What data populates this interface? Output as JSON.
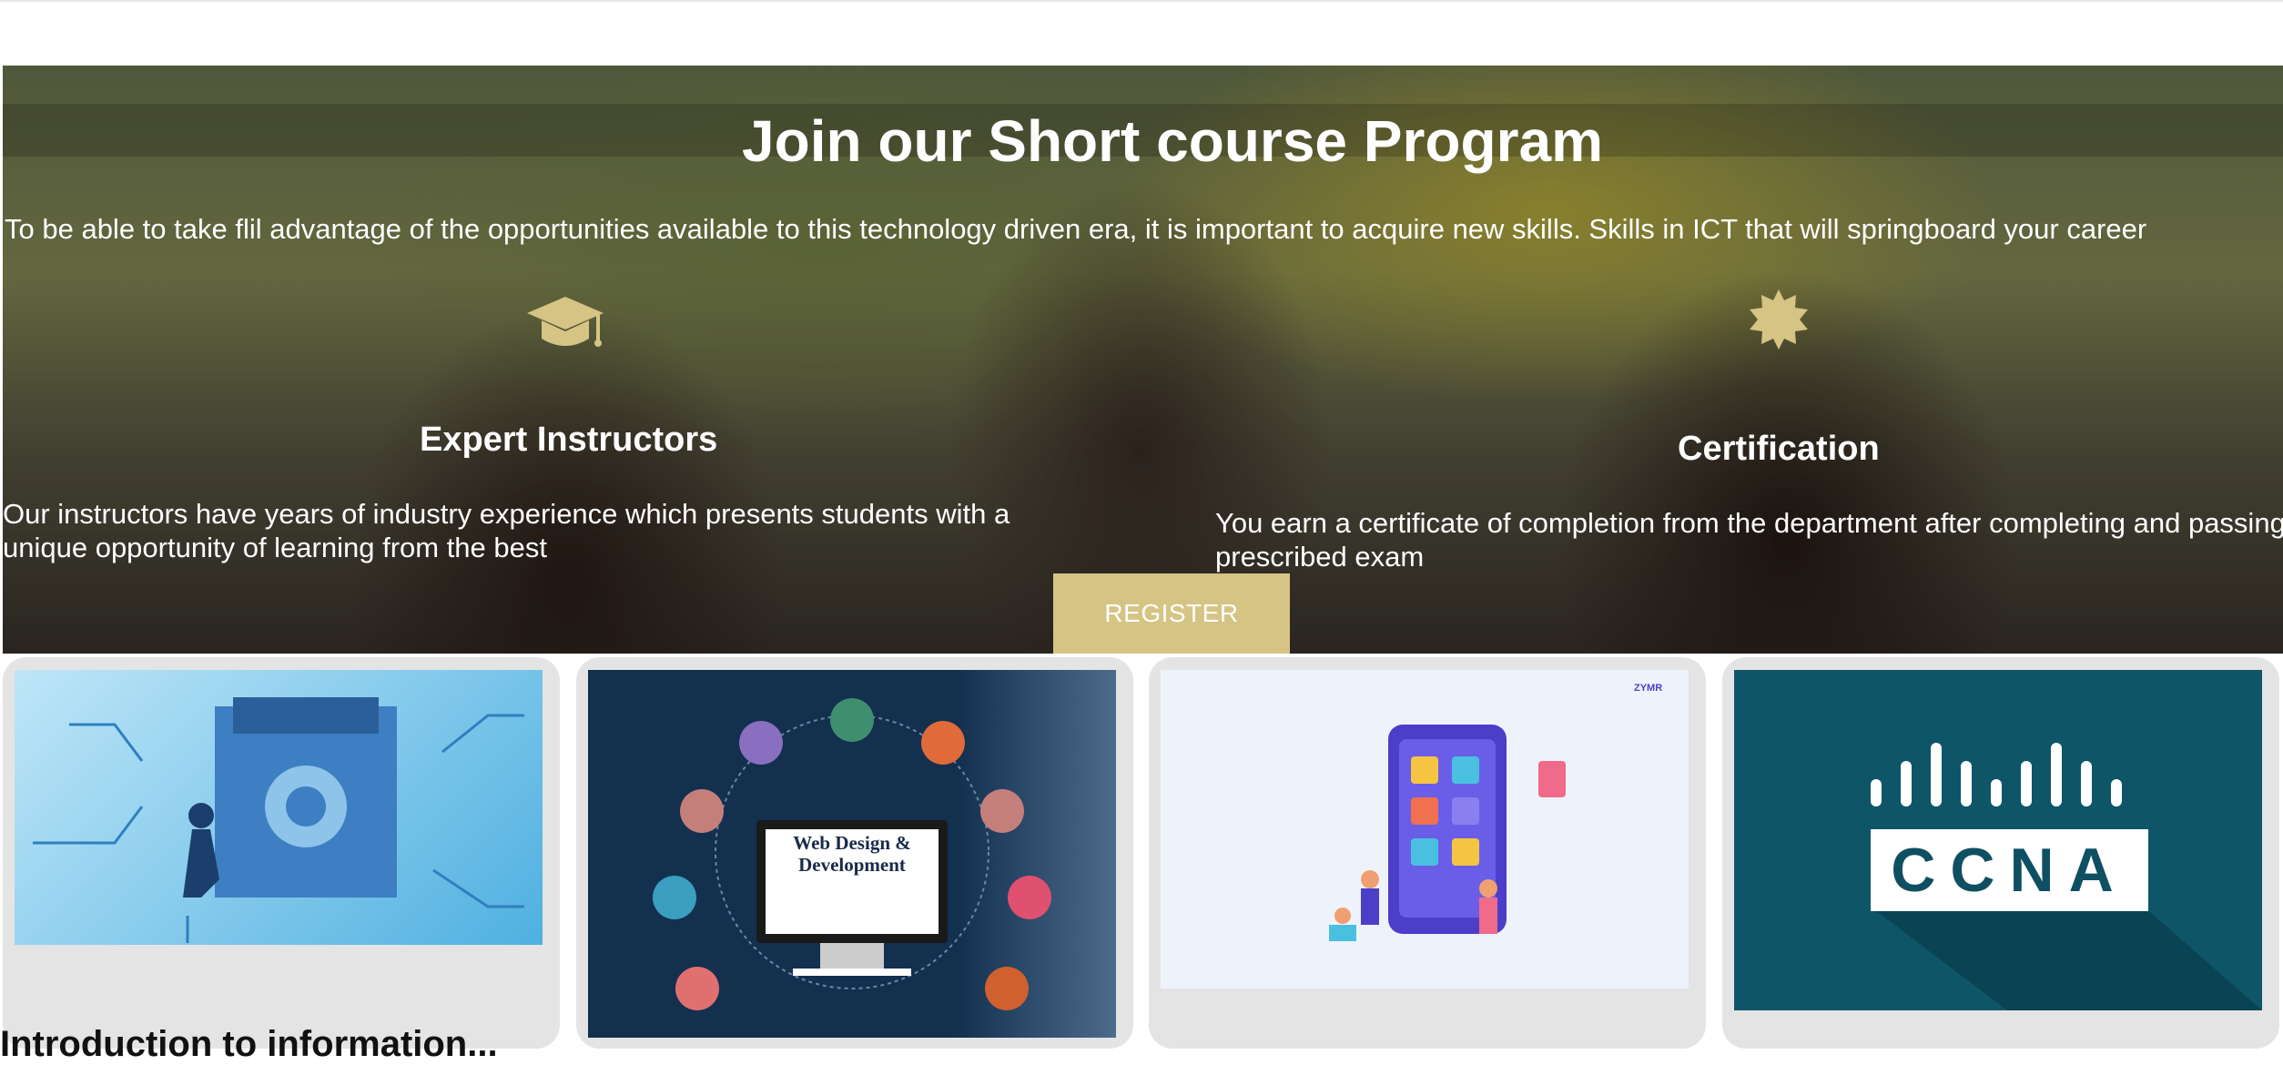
{
  "hero": {
    "title": "Join our Short course Program",
    "lead": "To be able to take flil advantage of the opportunities available to this technology driven era, it is important to acquire new skills. Skills in ICT that will springboard your career",
    "features": [
      {
        "icon": "graduation-cap-icon",
        "title": "Expert Instructors",
        "text": "Our instructors have years of industry experience which presents students with a unique opportunity of learning from the best"
      },
      {
        "icon": "certificate-seal-icon",
        "title": "Certification",
        "text": "You earn a certificate of completion from the department after completing and passing the prescribed exam"
      }
    ],
    "register_label": "REGISTER",
    "accent_color": "#d6c485"
  },
  "courses": [
    {
      "image": "cyber-security-illustration",
      "title": "Introduction to information..."
    },
    {
      "image": "web-design-development-illustration",
      "label_line1": "Web Design &",
      "label_line2": "Development"
    },
    {
      "image": "mobile-app-development-illustration",
      "badge": "ZYMR"
    },
    {
      "image": "ccna-logo",
      "label": "CCNA"
    }
  ]
}
